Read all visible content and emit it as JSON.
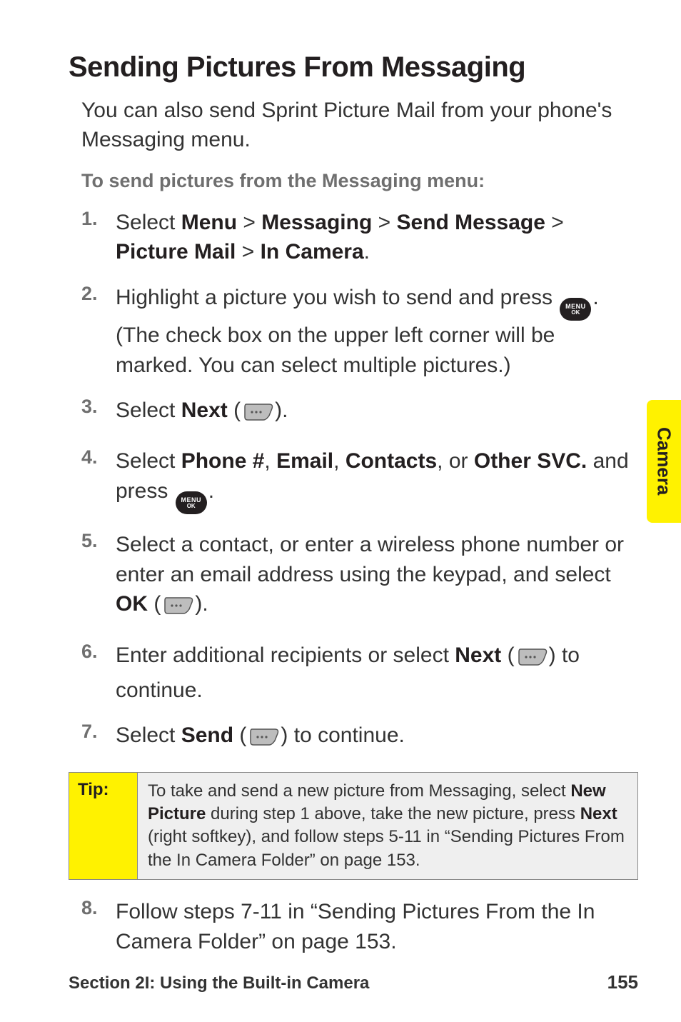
{
  "title": "Sending Pictures From Messaging",
  "intro": "You can also send Sprint Picture Mail from your phone's Messaging menu.",
  "lead": "To send pictures from the Messaging menu:",
  "menu_icon": {
    "top": "MENU",
    "bottom": "OK"
  },
  "steps": [
    {
      "num": "1.",
      "parts": [
        {
          "t": "Select "
        },
        {
          "t": "Menu",
          "b": true
        },
        {
          "t": " > "
        },
        {
          "t": "Messaging",
          "b": true
        },
        {
          "t": " > "
        },
        {
          "t": "Send Message",
          "b": true
        },
        {
          "t": " > "
        },
        {
          "t": "Picture Mail",
          "b": true
        },
        {
          "t": " > "
        },
        {
          "t": "In Camera",
          "b": true
        },
        {
          "t": "."
        }
      ]
    },
    {
      "num": "2.",
      "parts": [
        {
          "t": "Highlight a picture you wish to send and press "
        },
        {
          "icon": "menu"
        },
        {
          "t": ". (The check box on the upper left corner will be marked. You can select multiple pictures.)"
        }
      ]
    },
    {
      "num": "3.",
      "parts": [
        {
          "t": "Select "
        },
        {
          "t": "Next",
          "b": true
        },
        {
          "t": " ("
        },
        {
          "icon": "softkey"
        },
        {
          "t": ")."
        }
      ]
    },
    {
      "num": "4.",
      "parts": [
        {
          "t": "Select "
        },
        {
          "t": "Phone #",
          "b": true
        },
        {
          "t": ", "
        },
        {
          "t": "Email",
          "b": true
        },
        {
          "t": ", "
        },
        {
          "t": "Contacts",
          "b": true
        },
        {
          "t": ", or "
        },
        {
          "t": "Other SVC.",
          "b": true
        },
        {
          "t": " and press "
        },
        {
          "icon": "menu"
        },
        {
          "t": "."
        }
      ]
    },
    {
      "num": "5.",
      "parts": [
        {
          "t": "Select a contact, or enter a wireless phone number or enter an email address using the keypad, and select "
        },
        {
          "t": "OK",
          "b": true
        },
        {
          "t": " ("
        },
        {
          "icon": "softkey"
        },
        {
          "t": ")."
        }
      ]
    },
    {
      "num": "6.",
      "parts": [
        {
          "t": "Enter additional recipients or select "
        },
        {
          "t": "Next",
          "b": true
        },
        {
          "t": " ("
        },
        {
          "icon": "softkey"
        },
        {
          "t": ") to continue."
        }
      ]
    },
    {
      "num": "7.",
      "parts": [
        {
          "t": "Select "
        },
        {
          "t": "Send",
          "b": true
        },
        {
          "t": " ("
        },
        {
          "icon": "softkey"
        },
        {
          "t": ") to continue."
        }
      ]
    }
  ],
  "tip": {
    "label": "Tip:",
    "parts": [
      {
        "t": "To take and send a new picture from Messaging, select "
      },
      {
        "t": "New Picture",
        "b": true
      },
      {
        "t": " during step 1 above, take the new picture, press "
      },
      {
        "t": "Next",
        "b": true
      },
      {
        "t": " (right softkey), and follow steps 5-11 in “Sending Pictures From the In Camera Folder” on page 153."
      }
    ]
  },
  "post_step": {
    "num": "8.",
    "parts": [
      {
        "t": "Follow steps 7-11 in “Sending Pictures From the In Camera Folder” on page 153."
      }
    ]
  },
  "side_tab": "Camera",
  "footer": {
    "left": "Section 2I: Using the Built-in Camera",
    "right": "155"
  }
}
